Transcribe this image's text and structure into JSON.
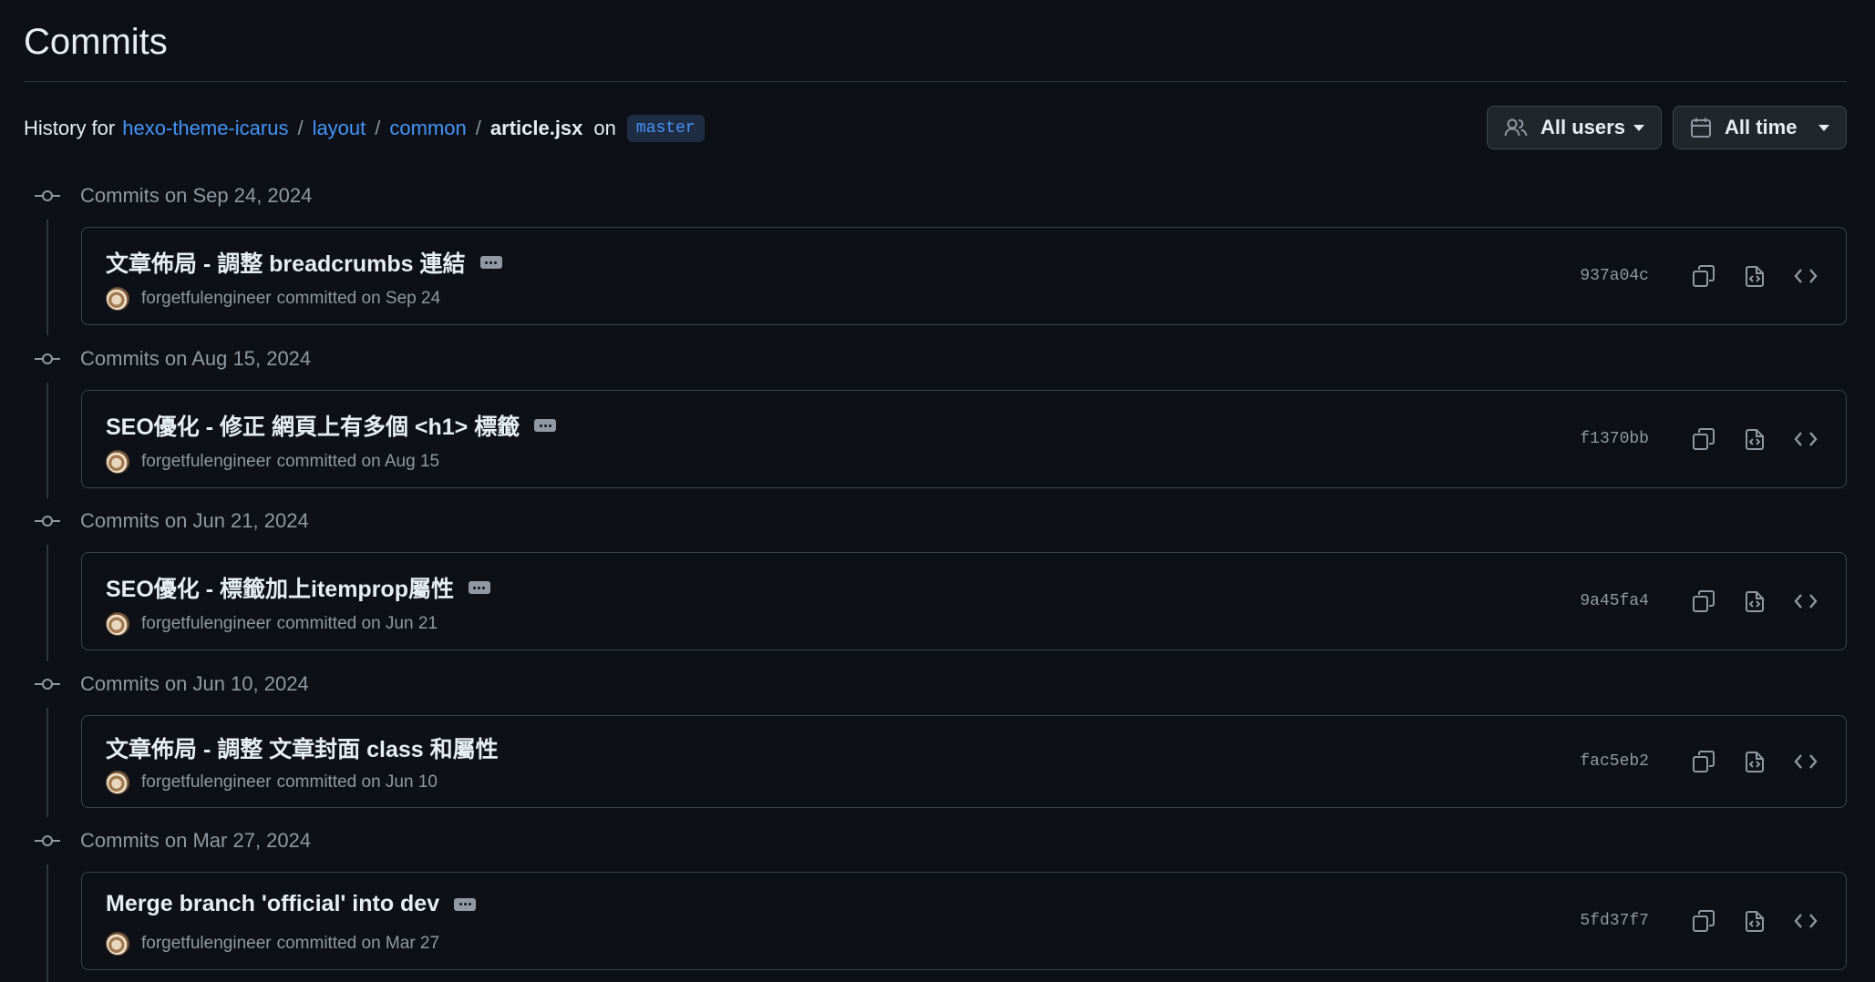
{
  "header": {
    "title": "Commits",
    "history_prefix": "History for",
    "breadcrumb": [
      "hexo-theme-icarus",
      "layout",
      "common"
    ],
    "breadcrumb_separator": "/",
    "file": "article.jsx",
    "on_label": "on",
    "branch": "master"
  },
  "filters": {
    "users_label": "All users",
    "time_label": "All time"
  },
  "groups": [
    {
      "heading": "Commits on Sep 24, 2024",
      "message": "文章佈局 - 調整 breadcrumbs 連結",
      "has_ellipsis": true,
      "author": "forgetfulengineer",
      "committed": "committed on Sep 24",
      "sha": "937a04c"
    },
    {
      "heading": "Commits on Aug 15, 2024",
      "message": "SEO優化 - 修正 網頁上有多個 <h1> 標籤",
      "has_ellipsis": true,
      "author": "forgetfulengineer",
      "committed": "committed on Aug 15",
      "sha": "f1370bb"
    },
    {
      "heading": "Commits on Jun 21, 2024",
      "message": "SEO優化 - 標籤加上itemprop屬性",
      "has_ellipsis": true,
      "author": "forgetfulengineer",
      "committed": "committed on Jun 21",
      "sha": "9a45fa4"
    },
    {
      "heading": "Commits on Jun 10, 2024",
      "message": "文章佈局 - 調整 文章封面 class 和屬性",
      "has_ellipsis": false,
      "author": "forgetfulengineer",
      "committed": "committed on Jun 10",
      "sha": "fac5eb2"
    },
    {
      "heading": "Commits on Mar 27, 2024",
      "message": "Merge branch 'official' into dev",
      "has_ellipsis": true,
      "author": "forgetfulengineer",
      "committed": "committed on Mar 27",
      "sha": "5fd37f7"
    }
  ],
  "icons": {
    "users_filter": "people-icon",
    "time_filter": "calendar-icon",
    "timeline_marker": "git-commit-icon",
    "copy": "copy-icon",
    "view_checks": "file-diff-icon",
    "browse": "code-icon"
  },
  "colors": {
    "background": "#0d1117",
    "link": "#4493f8",
    "muted": "#9198a1",
    "border": "#3d444d"
  }
}
